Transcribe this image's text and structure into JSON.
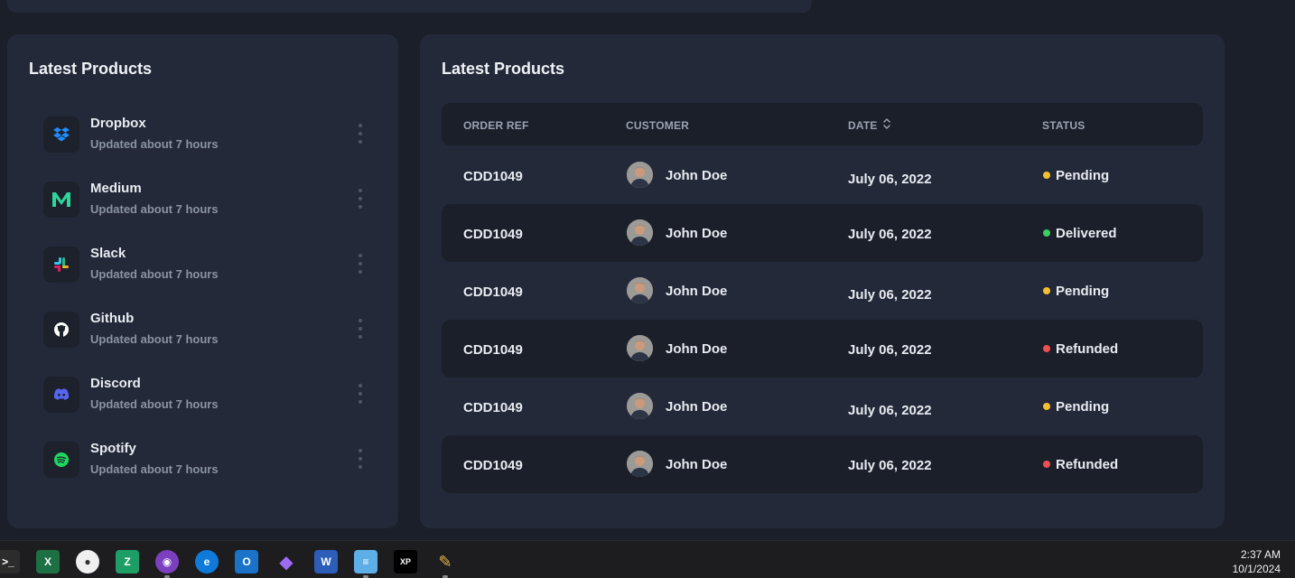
{
  "products_card": {
    "title": "Latest Products",
    "items": [
      {
        "name": "Dropbox",
        "updated": "Updated about 7 hours",
        "icon": "dropbox-icon"
      },
      {
        "name": "Medium",
        "updated": "Updated about 7 hours",
        "icon": "medium-icon"
      },
      {
        "name": "Slack",
        "updated": "Updated about 7 hours",
        "icon": "slack-icon"
      },
      {
        "name": "Github",
        "updated": "Updated about 7 hours",
        "icon": "github-icon"
      },
      {
        "name": "Discord",
        "updated": "Updated about 7 hours",
        "icon": "discord-icon"
      },
      {
        "name": "Spotify",
        "updated": "Updated about 7 hours",
        "icon": "spotify-icon"
      }
    ]
  },
  "orders_card": {
    "title": "Latest Products",
    "columns": [
      "ORDER REF",
      "CUSTOMER",
      "DATE",
      "STATUS"
    ],
    "rows": [
      {
        "ref": "CDD1049",
        "customer": "John Doe",
        "date": "July 06, 2022",
        "status": "Pending"
      },
      {
        "ref": "CDD1049",
        "customer": "John Doe",
        "date": "July 06, 2022",
        "status": "Delivered"
      },
      {
        "ref": "CDD1049",
        "customer": "John Doe",
        "date": "July 06, 2022",
        "status": "Pending"
      },
      {
        "ref": "CDD1049",
        "customer": "John Doe",
        "date": "July 06, 2022",
        "status": "Refunded"
      },
      {
        "ref": "CDD1049",
        "customer": "John Doe",
        "date": "July 06, 2022",
        "status": "Pending"
      },
      {
        "ref": "CDD1049",
        "customer": "John Doe",
        "date": "July 06, 2022",
        "status": "Refunded"
      }
    ]
  },
  "status_colors": {
    "Pending": "#f5c02f",
    "Delivered": "#3ccf62",
    "Refunded": "#ee4f4f"
  },
  "colors": {
    "background": "#1b1f2a",
    "card": "#232938"
  },
  "taskbar": {
    "apps": [
      "terminal-icon",
      "excel-icon",
      "app-icon",
      "zotero-icon",
      "github-desktop-icon",
      "edge-icon",
      "outlook-icon",
      "obsidian-icon",
      "word-icon",
      "notepad-icon",
      "xppen-icon",
      "pencil-icon"
    ],
    "time": "2:37 AM",
    "date": "10/1/2024"
  }
}
